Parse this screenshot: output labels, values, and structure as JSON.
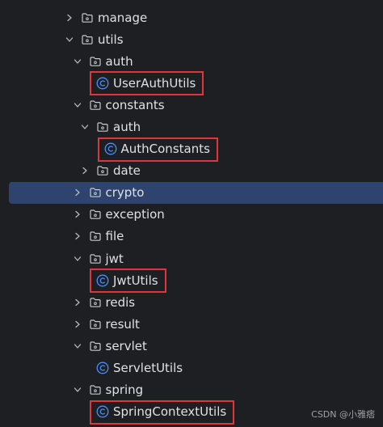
{
  "tree": {
    "items": [
      {
        "label": "manage",
        "type": "folder",
        "depth": 0,
        "expanded": false
      },
      {
        "label": "utils",
        "type": "folder",
        "depth": 0,
        "expanded": true
      },
      {
        "label": "auth",
        "type": "folder",
        "depth": 1,
        "expanded": true
      },
      {
        "label": "UserAuthUtils",
        "type": "class",
        "depth": 2,
        "highlighted": true
      },
      {
        "label": "constants",
        "type": "folder",
        "depth": 1,
        "expanded": true
      },
      {
        "label": "auth",
        "type": "folder",
        "depth": 2,
        "expanded": true
      },
      {
        "label": "AuthConstants",
        "type": "class",
        "depth": 3,
        "highlighted": true
      },
      {
        "label": "date",
        "type": "folder",
        "depth": 2,
        "expanded": false
      },
      {
        "label": "crypto",
        "type": "folder",
        "depth": 1,
        "expanded": false,
        "selected": true
      },
      {
        "label": "exception",
        "type": "folder",
        "depth": 1,
        "expanded": false
      },
      {
        "label": "file",
        "type": "folder",
        "depth": 1,
        "expanded": false
      },
      {
        "label": "jwt",
        "type": "folder",
        "depth": 1,
        "expanded": true
      },
      {
        "label": "JwtUtils",
        "type": "class",
        "depth": 2,
        "highlighted": true
      },
      {
        "label": "redis",
        "type": "folder",
        "depth": 1,
        "expanded": false
      },
      {
        "label": "result",
        "type": "folder",
        "depth": 1,
        "expanded": false
      },
      {
        "label": "servlet",
        "type": "folder",
        "depth": 1,
        "expanded": true
      },
      {
        "label": "ServletUtils",
        "type": "class",
        "depth": 2
      },
      {
        "label": "spring",
        "type": "folder",
        "depth": 1,
        "expanded": true
      },
      {
        "label": "SpringContextUtils",
        "type": "class",
        "depth": 2,
        "highlighted": true
      }
    ]
  },
  "colors": {
    "background": "#1e1f22",
    "selection": "#2e436e",
    "highlight_border": "#e0353a",
    "class_icon": "#4a8ef7",
    "text": "#dfe1e5"
  },
  "icons": {
    "folder": "folder-icon",
    "class": "class-icon",
    "collapsed": "chevron-right-icon",
    "expanded": "chevron-down-icon"
  },
  "watermark": "CSDN @小雅痞"
}
